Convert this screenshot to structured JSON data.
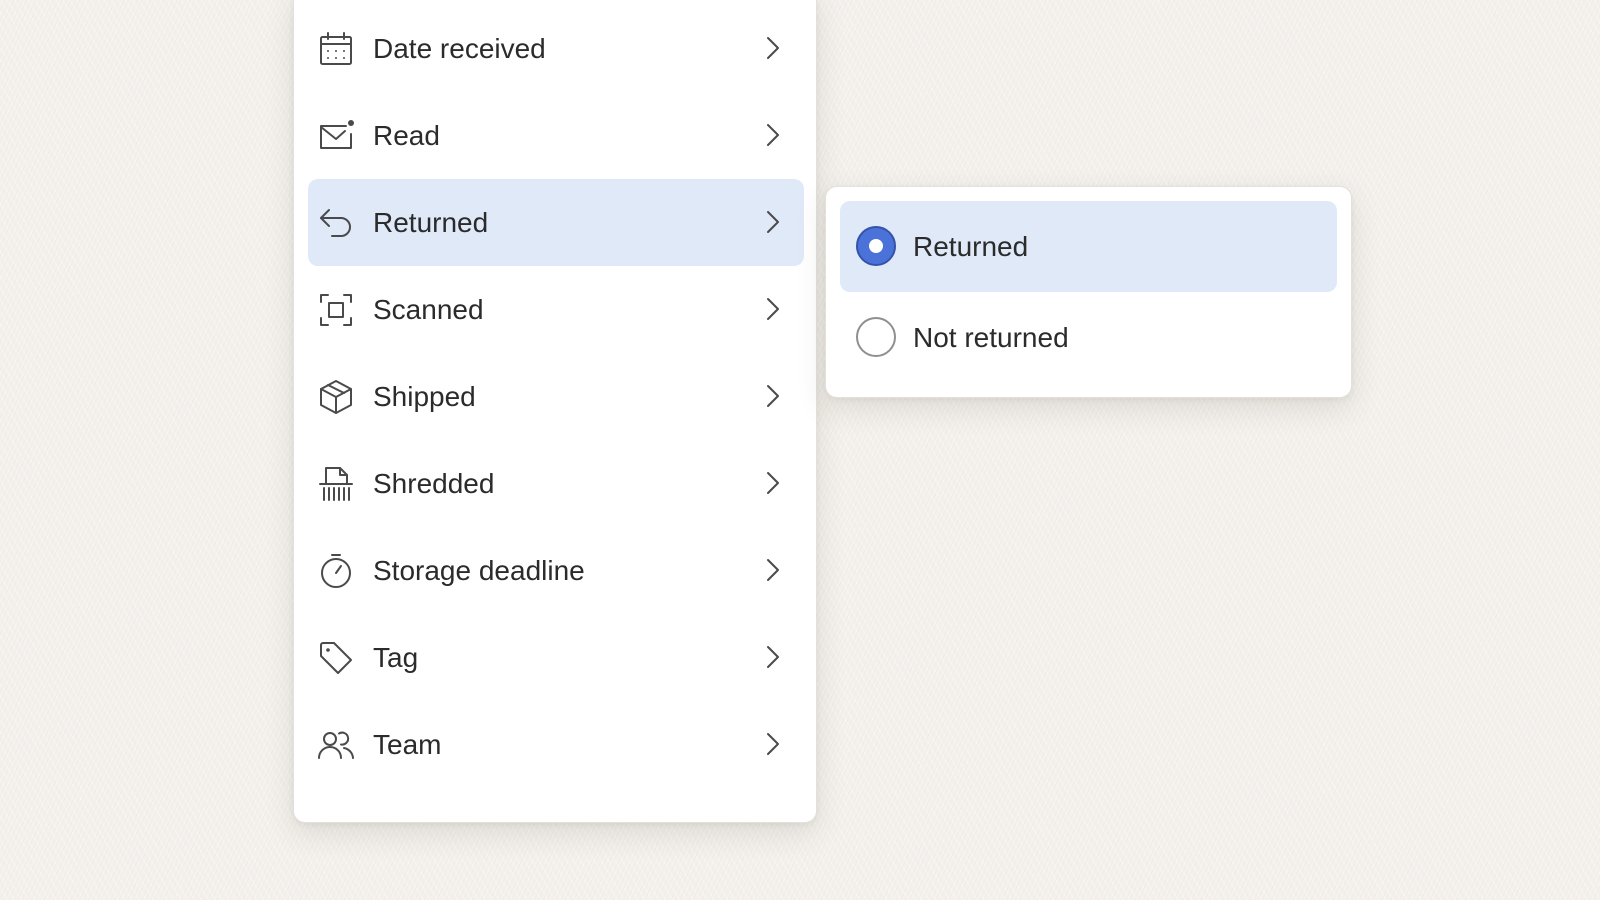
{
  "filter_menu": {
    "items": [
      {
        "label": "Date received",
        "icon": "calendar-icon"
      },
      {
        "label": "Read",
        "icon": "envelope-icon"
      },
      {
        "label": "Returned",
        "icon": "return-arrow-icon",
        "active": true
      },
      {
        "label": "Scanned",
        "icon": "scan-icon"
      },
      {
        "label": "Shipped",
        "icon": "box-icon"
      },
      {
        "label": "Shredded",
        "icon": "shredder-icon"
      },
      {
        "label": "Storage deadline",
        "icon": "stopwatch-icon"
      },
      {
        "label": "Tag",
        "icon": "tag-icon"
      },
      {
        "label": "Team",
        "icon": "team-icon"
      }
    ],
    "chevron_icon": "chevron-right-icon"
  },
  "submenu": {
    "options": [
      {
        "label": "Returned",
        "selected": true
      },
      {
        "label": "Not returned",
        "selected": false
      }
    ]
  },
  "colors": {
    "background": "#f4f1ec",
    "active_highlight": "#dfe9f8",
    "radio_selected": "#4a72d8",
    "text": "#2b2b2b"
  }
}
